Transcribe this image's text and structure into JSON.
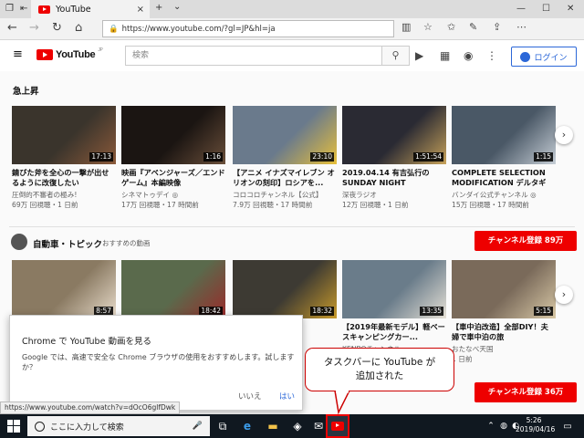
{
  "browser": {
    "tab_title": "YouTube",
    "tab_close": "×",
    "tab_new": "+",
    "tab_menu": "⌄",
    "url": "https://www.youtube.com/?gl=JP&hl=ja",
    "win_min": "—",
    "win_max": "☐",
    "win_close": "✕"
  },
  "youtube": {
    "logo_text": "YouTube",
    "logo_sup": "JP",
    "search_placeholder": "検索",
    "login_label": "ログイン"
  },
  "sections": {
    "trending": {
      "title": "急上昇",
      "videos": [
        {
          "title": "錆びた斧を全心の一撃が出せるように改復したい",
          "channel": "圧倒的不審者の極み!",
          "meta": "69万 回視聴・1 日前",
          "duration": "17:13",
          "bg": "#3a342c",
          "fg": "#8b5a3a"
        },
        {
          "title": "映画『アベンジャーズ／エンドゲーム』本編映像",
          "channel": "シネマトゥデイ ◎",
          "meta": "17万 回視聴・17 時間前",
          "duration": "1:16",
          "bg": "#1b1512",
          "fg": "#6a4f3a"
        },
        {
          "title": "【アニメ イナズマイレブン オリオンの刻印】ロシアを...",
          "channel": "コロコロチャンネル【公式】",
          "meta": "7.9万 回視聴・17 時間前",
          "duration": "23:10",
          "bg": "#6a7a8c",
          "fg": "#e8c03a"
        },
        {
          "title": "2019.04.14 有吉弘行の SUNDAY NIGHT DREAMER ...",
          "channel": "深夜ラジオ",
          "meta": "12万 回視聴・1 日前",
          "duration": "1:51:54",
          "bg": "#2a2a33",
          "fg": "#c7a25a"
        },
        {
          "title": "COMPLETE SELECTION MODIFICATION デルタギア...",
          "channel": "バンダイ公式チャンネル ◎",
          "meta": "15万 回視聴・17 時間前",
          "duration": "1:15",
          "bg": "#4a5866",
          "fg": "#c6ced6"
        }
      ]
    },
    "auto": {
      "title": "自動車・トピック",
      "subtitle": "おすすめの動画",
      "subscribe": "チャンネル登録 89万",
      "videos": [
        {
          "title": "",
          "channel": "",
          "meta": "",
          "duration": "8:57",
          "bg": "#8a7a62",
          "fg": "#e8dccb"
        },
        {
          "title": "",
          "channel": "",
          "meta": "",
          "duration": "18:42",
          "bg": "#5a6a4c",
          "fg": "#9a2a2a"
        },
        {
          "title": "を魔",
          "channel": "",
          "meta": "",
          "duration": "18:32",
          "bg": "#3d3a33",
          "fg": "#c89a2a"
        },
        {
          "title": "【2019年最新モデル】軽ベースキャンピングカー...",
          "channel": "KENBOチャンネル",
          "meta": "",
          "duration": "13:35",
          "bg": "#6a7c8a",
          "fg": "#e6e1d6"
        },
        {
          "title": "【車中泊改造】全部DIY！夫婦で車中泊の旅",
          "channel": "おたなべ天国",
          "meta": "1 日前",
          "duration": "5:15",
          "bg": "#7a6a5a",
          "fg": "#d8c8a6"
        }
      ]
    },
    "third": {
      "subscribe": "チャンネル登録 36万"
    }
  },
  "popup": {
    "title": "Chrome で YouTube 動画を見る",
    "body": "Google では、高速で安全な Chrome ブラウザの使用をおすすめします。試しますか？",
    "no": "いいえ",
    "yes": "はい"
  },
  "callout": {
    "line1": "タスクバーに YouTube が",
    "line2": "追加された"
  },
  "status_url": "https://www.youtube.com/watch?v=dOcO6glfDwk",
  "taskbar": {
    "search_placeholder": "ここに入力して検索",
    "time": "5:26",
    "date": "2019/04/16"
  },
  "colors": {
    "accent_red": "#e00",
    "login_blue": "#2b67d8"
  }
}
